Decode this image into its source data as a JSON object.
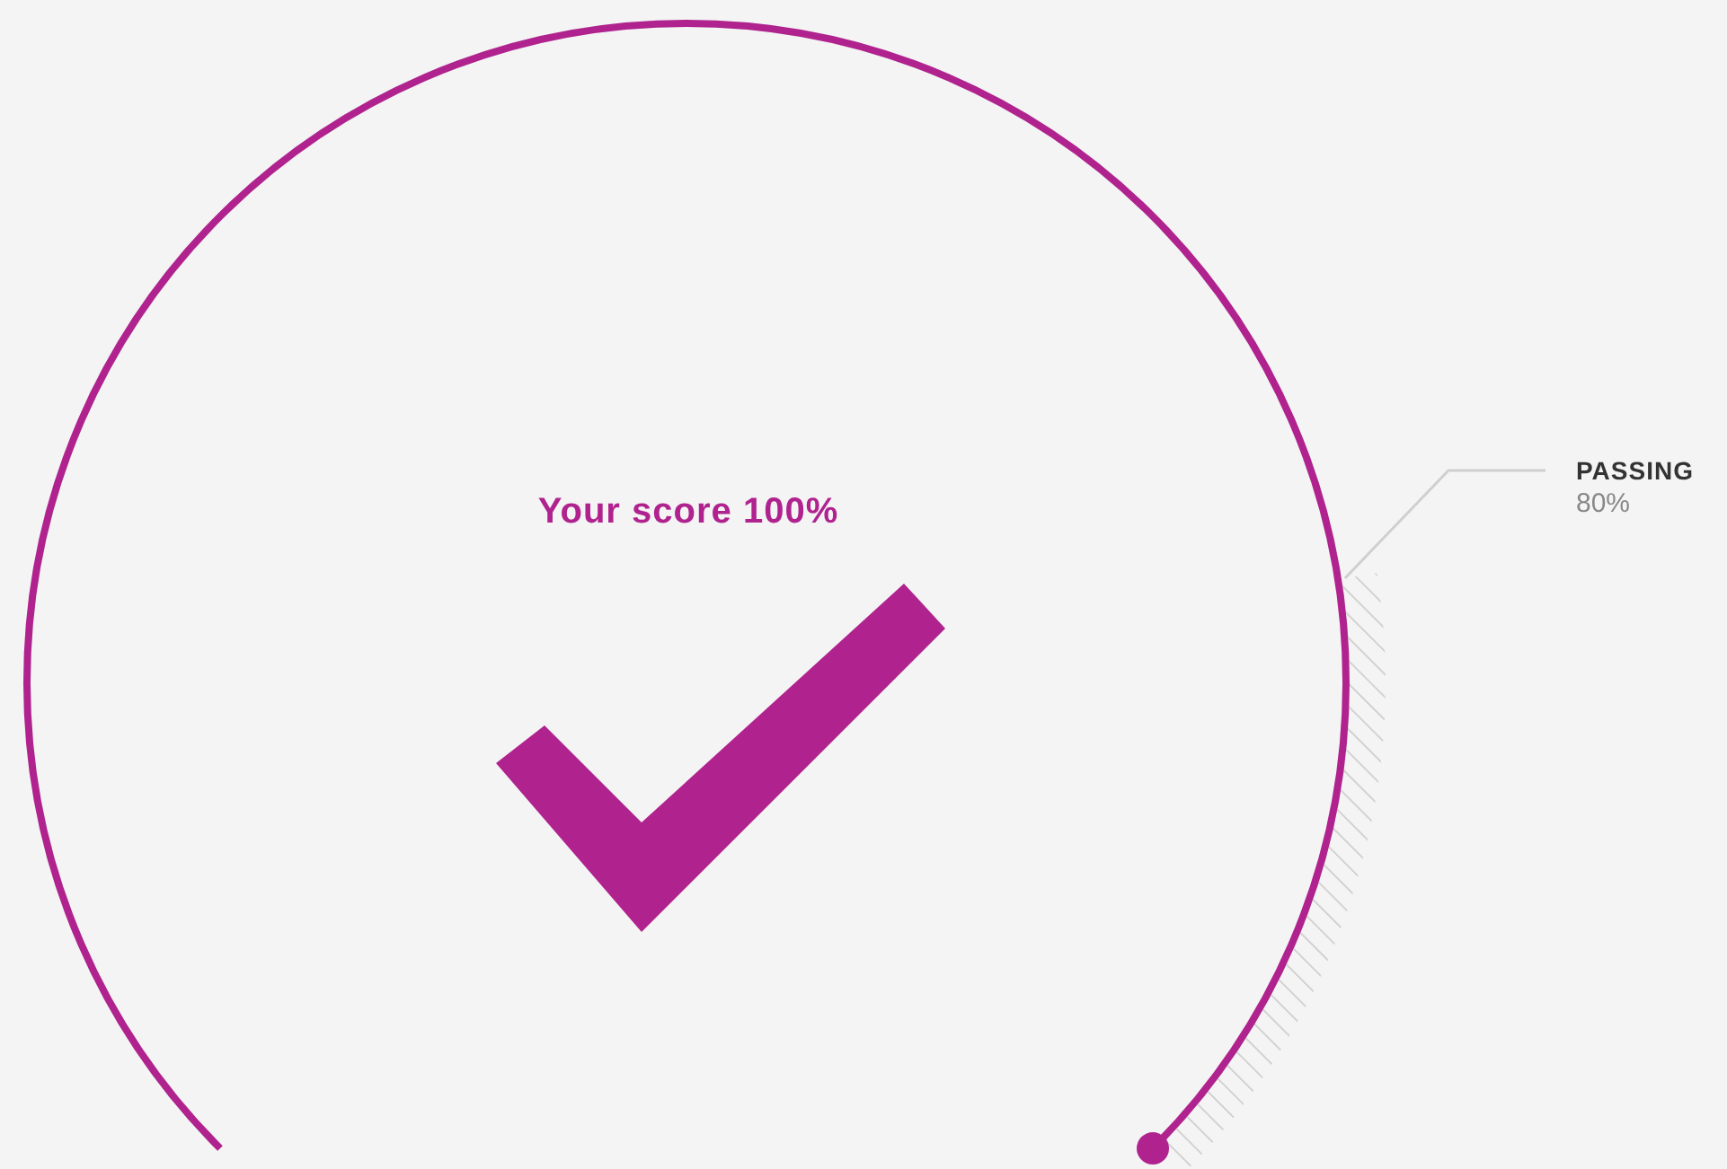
{
  "score": {
    "label": "Your score 100%",
    "level": 1,
    "passed": true
  },
  "passing": {
    "label": "PASSING",
    "value": "80%",
    "level": 0.8
  }
}
